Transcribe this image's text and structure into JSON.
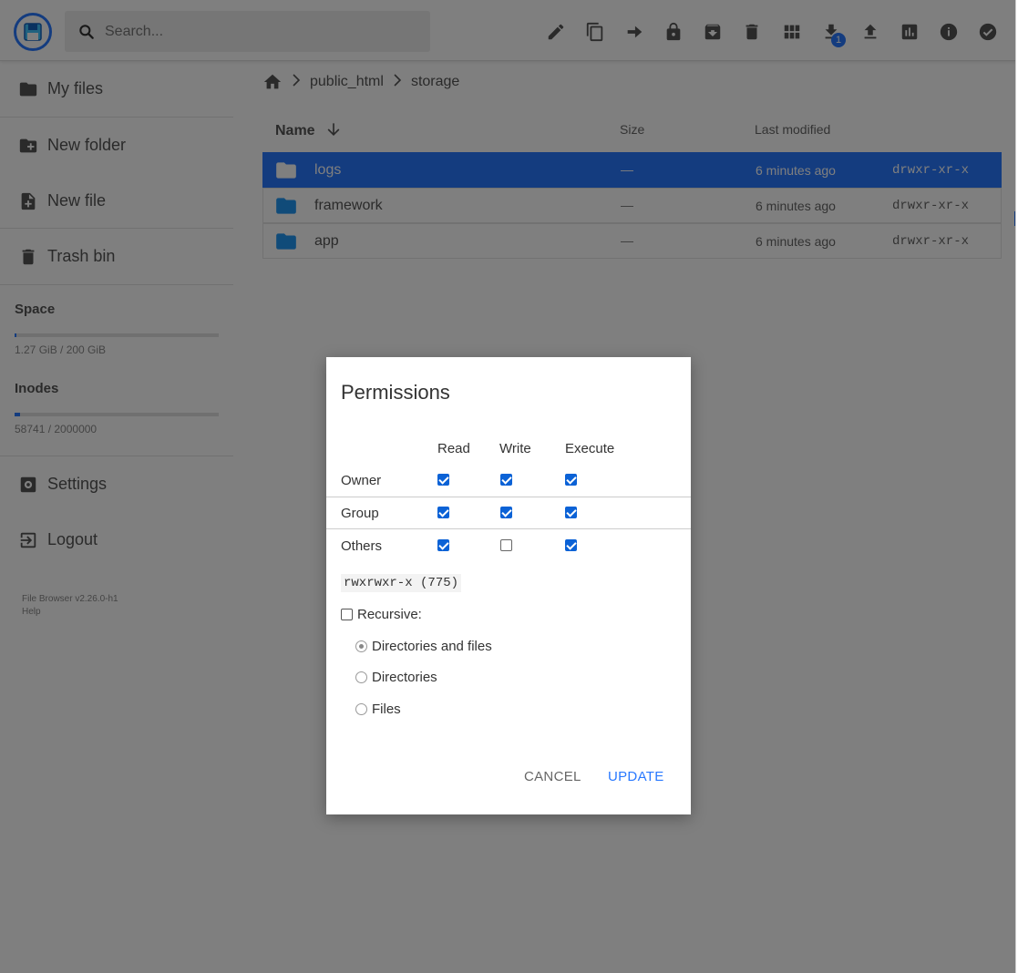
{
  "header": {
    "search_placeholder": "Search...",
    "download_badge": "1",
    "toolbar_icons": [
      "pencil-icon",
      "copy-icon",
      "move-icon",
      "lock-icon",
      "archive-icon",
      "trash-icon",
      "grid-icon",
      "download-icon",
      "upload-icon",
      "chart-icon",
      "info-icon",
      "check-circle-icon"
    ]
  },
  "sidebar": {
    "items": [
      {
        "label": "My files",
        "icon": "folder-icon"
      },
      {
        "label": "New folder",
        "icon": "folder-plus-icon"
      },
      {
        "label": "New file",
        "icon": "file-plus-icon"
      },
      {
        "label": "Trash bin",
        "icon": "trash-icon"
      },
      {
        "label": "Settings",
        "icon": "gear-icon"
      },
      {
        "label": "Logout",
        "icon": "logout-icon"
      }
    ],
    "space": {
      "title": "Space",
      "text": "1.27 GiB / 200 GiB",
      "fraction": 0.006
    },
    "inodes": {
      "title": "Inodes",
      "text": "58741 / 2000000",
      "fraction": 0.029
    },
    "version": "File Browser v2.26.0-h1",
    "help": "Help"
  },
  "breadcrumb": [
    "public_html",
    "storage"
  ],
  "list": {
    "headers": {
      "name": "Name",
      "size": "Size",
      "modified": "Last modified"
    },
    "rows": [
      {
        "name": "logs",
        "size": "—",
        "modified": "6 minutes ago",
        "perm": "drwxr-xr-x",
        "selected": true
      },
      {
        "name": "framework",
        "size": "—",
        "modified": "6 minutes ago",
        "perm": "drwxr-xr-x",
        "selected": false
      },
      {
        "name": "app",
        "size": "—",
        "modified": "6 minutes ago",
        "perm": "drwxr-xr-x",
        "selected": false
      }
    ]
  },
  "dialog": {
    "title": "Permissions",
    "columns": [
      "Read",
      "Write",
      "Execute"
    ],
    "rows": [
      {
        "label": "Owner",
        "read": true,
        "write": true,
        "execute": true
      },
      {
        "label": "Group",
        "read": true,
        "write": true,
        "execute": true
      },
      {
        "label": "Others",
        "read": true,
        "write": false,
        "execute": true
      }
    ],
    "permission_string": "rwxrwxr-x (775)",
    "recursive_label": "Recursive:",
    "recursive_checked": false,
    "options": [
      {
        "label": "Directories and files",
        "selected": true
      },
      {
        "label": "Directories",
        "selected": false
      },
      {
        "label": "Files",
        "selected": false
      }
    ],
    "cancel_label": "CANCEL",
    "update_label": "UPDATE"
  },
  "colors": {
    "accent": "#2979ff",
    "overlay": "rgba(0,0,0,0.5)"
  }
}
